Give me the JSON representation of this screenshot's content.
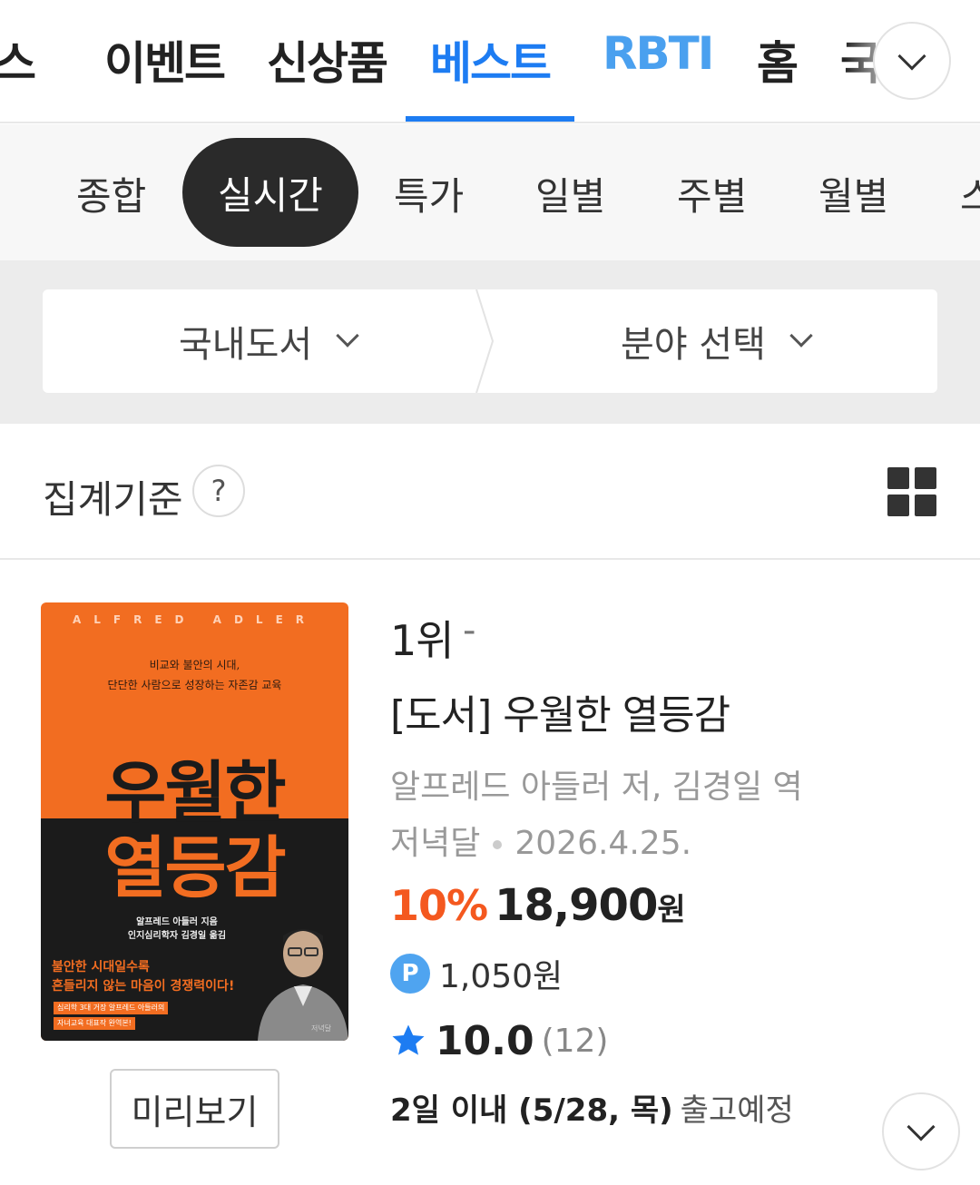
{
  "top_nav": {
    "tabs": [
      {
        "label": "스"
      },
      {
        "label": "이벤트"
      },
      {
        "label": "신상품"
      },
      {
        "label": "베스트"
      },
      {
        "label": "RBTI"
      },
      {
        "label": "홈"
      },
      {
        "label": "국"
      }
    ],
    "active_index": 3,
    "expand_icon": "chevron-down-icon",
    "accent_color": "#1d7cf2"
  },
  "sub_tabs": {
    "items": [
      "종합",
      "실시간",
      "특가",
      "일별",
      "주별",
      "월별",
      "스"
    ],
    "active_index": 1
  },
  "filters": {
    "category": "국내도서",
    "field": "분야 선택"
  },
  "criteria": {
    "label": "집계기준",
    "help_icon_text": "?",
    "view_icon": "grid-view-icon"
  },
  "product": {
    "rank": "1위",
    "rank_change": "-",
    "title": "[도서] 우월한 열등감",
    "authors": "알프레드 아들러 저, 김경일 역",
    "publisher": "저녁달",
    "pub_date": "2026.4.25.",
    "discount": "10%",
    "price": "18,900",
    "price_unit": "원",
    "point_badge": "P",
    "points": "1,050원",
    "rating": "10.0",
    "review_count": "(12)",
    "shipping_strong": "2일 이내 (5/28, 목)",
    "shipping_rest": "출고예정",
    "preview_label": "미리보기",
    "discount_color": "#f4581f",
    "cover": {
      "author_en": "ALFRED ADLER",
      "tagline_1": "비교와 불안의 시대,",
      "tagline_2": "단단한 사람으로 성장하는 자존감 교육",
      "title_line1": "우월한",
      "title_line2": "열등감",
      "credit_1": "알프레드 아들러 지음",
      "credit_2": "인지심리학자 김경일 옮김",
      "catch_1": "불안한 시대일수록",
      "catch_2": "흔들리지 않는 마음이 경쟁력이다!",
      "band_1": "심리학 3대 거장 알프레드 아들러의",
      "band_2": "자녀교육 대표작 완역본!",
      "publisher_mark": "저녁달",
      "colors": {
        "orange": "#f26d21",
        "black": "#1b1b1b"
      }
    }
  }
}
